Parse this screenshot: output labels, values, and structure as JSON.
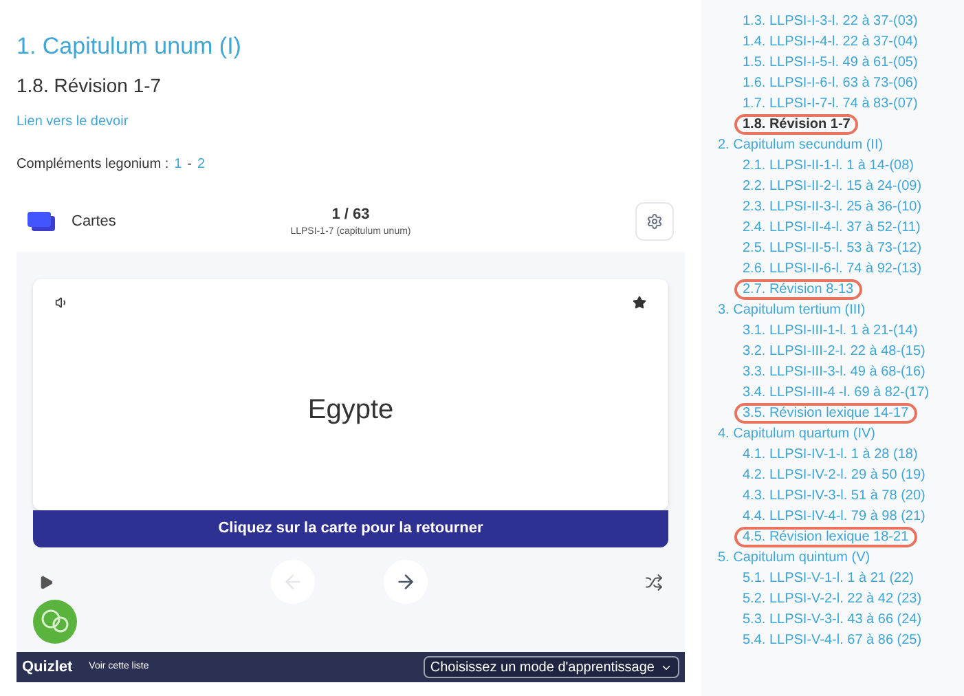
{
  "page": {
    "chapter_title": "1. Capitulum unum (I)",
    "lesson_title": "1.8. Révision 1-7",
    "assignment_link": "Lien vers le devoir",
    "complements_label": "Compléments legonium :",
    "complements_links": [
      "1",
      "2"
    ],
    "complements_separator": "-"
  },
  "flashcards": {
    "mode": "Cartes",
    "counter": "1 / 63",
    "set_name": "LLPSI-1-7 (capitulum unum)",
    "card_term": "Egypte",
    "flip_bar": "Cliquez sur la carte pour la retourner",
    "prev_disabled": true,
    "next_disabled": false,
    "footer_logo": "Quizlet",
    "footer_link": "Voir cette liste",
    "mode_select": "Choisissez un mode d'apprentissage"
  },
  "sidebar": {
    "items": [
      {
        "children": [
          {
            "label": "1.3. LLPSI-I-3-l. 22 à 37-(03)",
            "current": false,
            "circled": false
          },
          {
            "label": "1.4. LLPSI-I-4-l. 22 à 37-(04)",
            "current": false,
            "circled": false
          },
          {
            "label": "1.5. LLPSI-I-5-l. 49 à 61-(05)",
            "current": false,
            "circled": false
          },
          {
            "label": "1.6. LLPSI-I-6-l. 63 à 73-(06)",
            "current": false,
            "circled": false
          },
          {
            "label": "1.7. LLPSI-I-7-l. 74 à 83-(07)",
            "current": false,
            "circled": false
          },
          {
            "label": "1.8. Révision 1-7",
            "current": true,
            "circled": true
          }
        ]
      },
      {
        "label": "2. Capitulum secundum (II)",
        "children": [
          {
            "label": "2.1. LLPSI-II-1-l. 1 à 14-(08)",
            "current": false,
            "circled": false
          },
          {
            "label": "2.2. LLPSI-II-2-l. 15 à 24-(09)",
            "current": false,
            "circled": false
          },
          {
            "label": "2.3. LLPSI-II-3-l. 25 à 36-(10)",
            "current": false,
            "circled": false
          },
          {
            "label": "2.4. LLPSI-II-4-l. 37 à 52-(11)",
            "current": false,
            "circled": false
          },
          {
            "label": "2.5. LLPSI-II-5-l. 53 à 73-(12)",
            "current": false,
            "circled": false
          },
          {
            "label": "2.6. LLPSI-II-6-l. 74 à 92-(13)",
            "current": false,
            "circled": false
          },
          {
            "label": "2.7. Révision 8-13",
            "current": false,
            "circled": true
          }
        ]
      },
      {
        "label": "3. Capitulum tertium (III)",
        "children": [
          {
            "label": "3.1. LLPSI-III-1-l. 1 à 21-(14)",
            "current": false,
            "circled": false
          },
          {
            "label": "3.2. LLPSI-III-2-l. 22 à 48-(15)",
            "current": false,
            "circled": false
          },
          {
            "label": "3.3. LLPSI-III-3-l. 49 à 68-(16)",
            "current": false,
            "circled": false
          },
          {
            "label": "3.4. LLPSI-III-4 -l. 69 à 82-(17)",
            "current": false,
            "circled": false
          },
          {
            "label": "3.5. Révision lexique 14-17",
            "current": false,
            "circled": true
          }
        ]
      },
      {
        "label": "4. Capitulum quartum (IV)",
        "children": [
          {
            "label": "4.1. LLPSI-IV-1-l. 1 à 28 (18)",
            "current": false,
            "circled": false
          },
          {
            "label": "4.2. LLPSI-IV-2-l. 29 à 50 (19)",
            "current": false,
            "circled": false
          },
          {
            "label": "4.3. LLPSI-IV-3-l. 51 à 78 (20)",
            "current": false,
            "circled": false
          },
          {
            "label": "4.4. LLPSI-IV-4-l. 79 à 98 (21)",
            "current": false,
            "circled": false
          },
          {
            "label": "4.5. Révision lexique 18-21",
            "current": false,
            "circled": true
          }
        ]
      },
      {
        "label": "5. Capitulum quintum (V)",
        "children": [
          {
            "label": "5.1. LLPSI-V-1-l. 1 à 21 (22)",
            "current": false,
            "circled": false
          },
          {
            "label": "5.2. LLPSI-V-2-l. 22 à 42 (23)",
            "current": false,
            "circled": false
          },
          {
            "label": "5.3. LLPSI-V-3-l. 43 à 66 (24)",
            "current": false,
            "circled": false
          },
          {
            "label": "5.4. LLPSI-V-4-l. 67 à 86 (25)",
            "current": false,
            "circled": false
          }
        ]
      }
    ]
  }
}
